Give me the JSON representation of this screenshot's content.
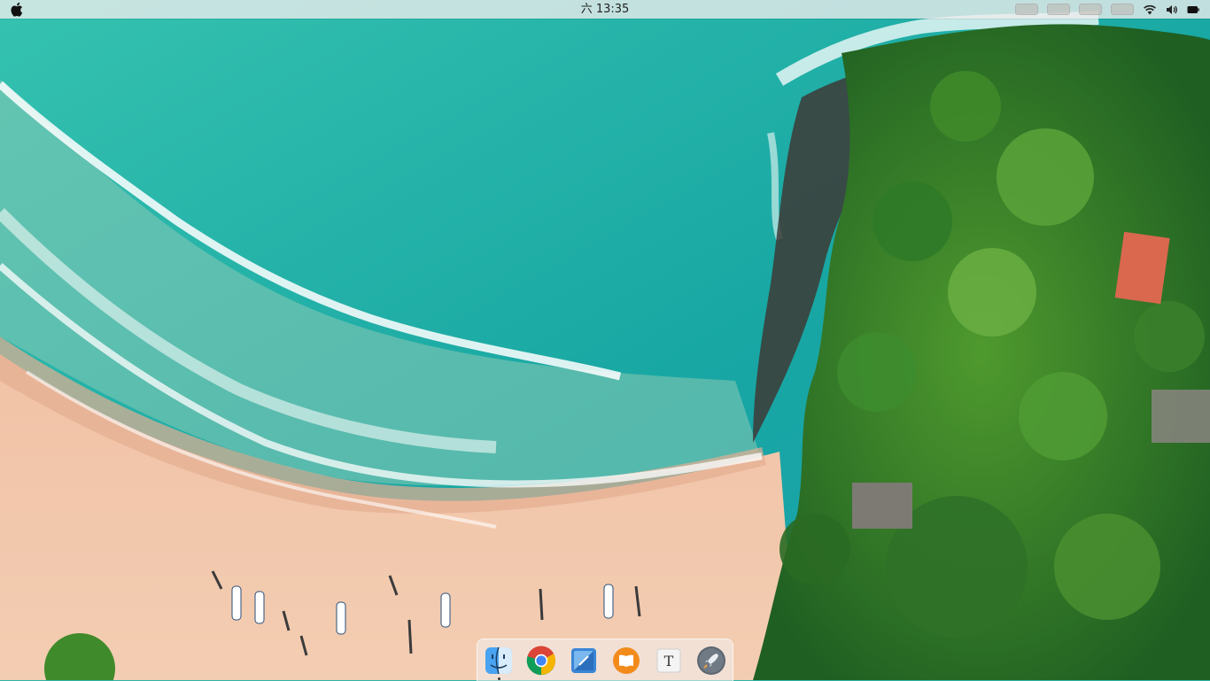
{
  "menubar": {
    "apple_icon": "apple-logo-icon",
    "clock_text": "六 13:35",
    "status_icons": [
      "app-indicator-1",
      "app-indicator-2",
      "app-indicator-3",
      "app-indicator-4",
      "wifi-icon",
      "volume-icon",
      "battery-icon"
    ]
  },
  "dock": {
    "items": [
      {
        "name": "finder",
        "icon": "finder-icon"
      },
      {
        "name": "chrome",
        "icon": "chrome-icon"
      },
      {
        "name": "preview",
        "icon": "preview-icon"
      },
      {
        "name": "books",
        "icon": "books-icon"
      },
      {
        "name": "text-editor",
        "icon": "text-editor-icon",
        "glyph": "T"
      },
      {
        "name": "launchpad",
        "icon": "launchpad-icon"
      }
    ]
  },
  "colors": {
    "ocean": "#1fb3a5",
    "deep_ocean": "#139c9b",
    "sand": "#f0bfa0",
    "forest": "#2e7d32",
    "menubar": "#ebecec"
  }
}
